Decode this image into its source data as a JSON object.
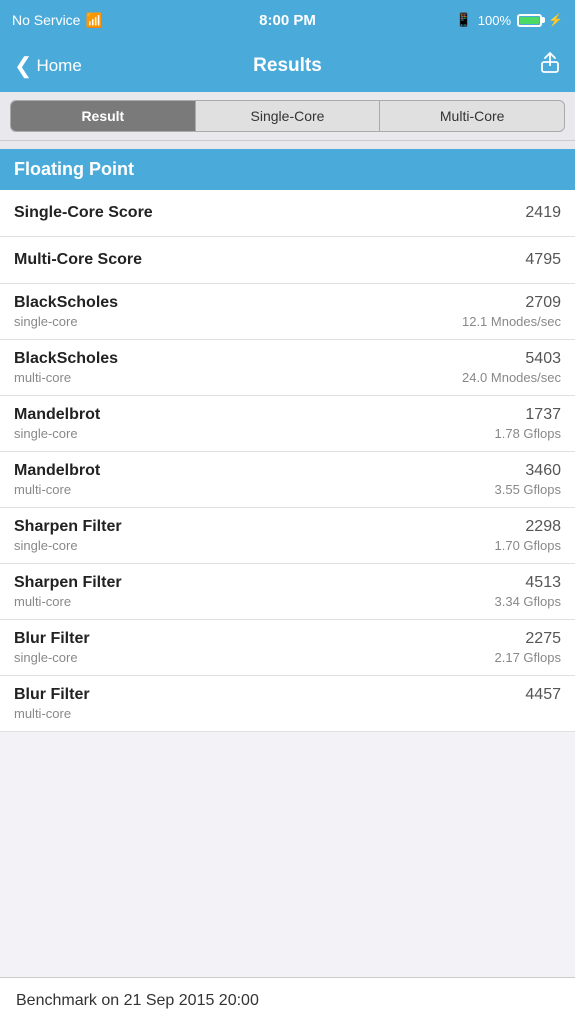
{
  "statusBar": {
    "carrier": "No Service",
    "time": "8:00 PM",
    "battery": "100%"
  },
  "navBar": {
    "backLabel": "Home",
    "title": "Results",
    "shareLabel": "⬆"
  },
  "segments": {
    "items": [
      "Result",
      "Single-Core",
      "Multi-Core"
    ],
    "activeIndex": 0
  },
  "section": {
    "title": "Floating Point"
  },
  "scores": [
    {
      "label": "Single-Core Score",
      "value": "2419"
    },
    {
      "label": "Multi-Core Score",
      "value": "4795"
    }
  ],
  "benchmarks": [
    {
      "name": "BlackScholes",
      "sub": "single-core",
      "score": "2709",
      "unit": "12.1 Mnodes/sec"
    },
    {
      "name": "BlackScholes",
      "sub": "multi-core",
      "score": "5403",
      "unit": "24.0 Mnodes/sec"
    },
    {
      "name": "Mandelbrot",
      "sub": "single-core",
      "score": "1737",
      "unit": "1.78 Gflops"
    },
    {
      "name": "Mandelbrot",
      "sub": "multi-core",
      "score": "3460",
      "unit": "3.55 Gflops"
    },
    {
      "name": "Sharpen Filter",
      "sub": "single-core",
      "score": "2298",
      "unit": "1.70 Gflops"
    },
    {
      "name": "Sharpen Filter",
      "sub": "multi-core",
      "score": "4513",
      "unit": "3.34 Gflops"
    },
    {
      "name": "Blur Filter",
      "sub": "single-core",
      "score": "2275",
      "unit": "2.17 Gflops"
    },
    {
      "name": "Blur Filter",
      "sub": "multi-core",
      "score": "4457",
      "unit": ""
    }
  ],
  "footer": {
    "text": "Benchmark on 21 Sep 2015 20:00"
  }
}
